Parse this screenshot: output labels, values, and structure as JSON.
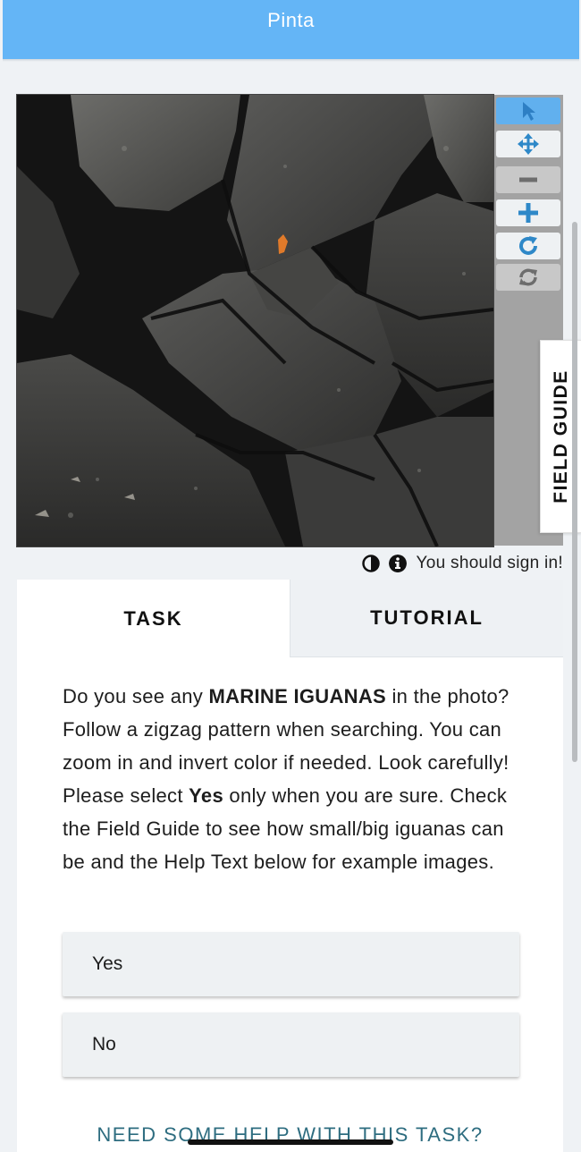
{
  "header": {
    "title": "Pinta"
  },
  "viewer": {
    "tools": [
      {
        "name": "pointer-icon",
        "state": "active"
      },
      {
        "name": "pan-icon",
        "state": "normal"
      },
      {
        "name": "zoom-out-icon",
        "state": "disabled"
      },
      {
        "name": "zoom-in-icon",
        "state": "normal"
      },
      {
        "name": "rotate-icon",
        "state": "normal"
      },
      {
        "name": "reset-icon",
        "state": "disabled"
      }
    ],
    "field_guide_label": "FIELD GUIDE"
  },
  "meta": {
    "invert_icon": "half-circle-icon",
    "info_icon": "info-icon",
    "signin_text": "You should sign in!"
  },
  "tabs": {
    "task": "TASK",
    "tutorial": "TUTORIAL"
  },
  "task": {
    "q1": "Do you see any ",
    "q2": "MARINE IGUANAS",
    "q3": " in the photo? Follow a zigzag pattern when searching. You can zoom in and invert color if needed. Look carefully! Please select ",
    "q4": "Yes",
    "q5": " only when you are sure. Check the Field Guide to see how small/big iguanas can be and the Help Text below for example images.",
    "answers": [
      "Yes",
      "No"
    ],
    "help_link": "NEED SOME HELP WITH THIS TASK?"
  },
  "colors": {
    "header": "#64b5f6",
    "accent": "#2e88c8",
    "link": "#2e6d80"
  }
}
